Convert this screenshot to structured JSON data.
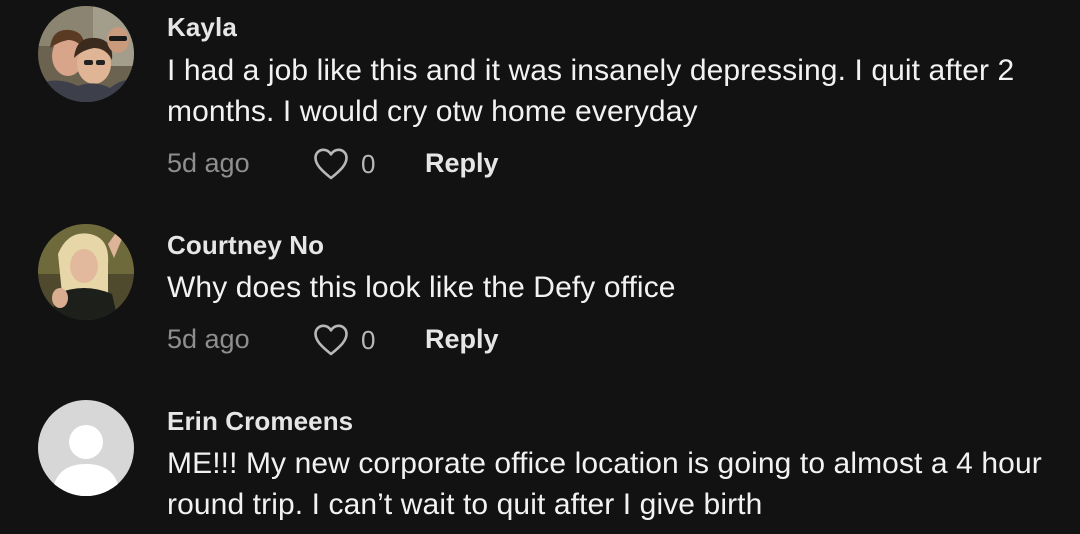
{
  "colors": {
    "background": "#121212",
    "username": "#e6e6e6",
    "text": "#f2f2f2",
    "muted": "#8e8e8e"
  },
  "comments": [
    {
      "username": "Kayla",
      "text": "I had a job like this and it was insanely depressing. I quit after 2 months. I would cry otw home everyday",
      "timestamp": "5d ago",
      "likes": "0",
      "reply_label": "Reply",
      "avatar": "photo-avatar-group"
    },
    {
      "username": "Courtney No",
      "text": "Why does this look like the Defy office",
      "timestamp": "5d ago",
      "likes": "0",
      "reply_label": "Reply",
      "avatar": "photo-avatar-selfie"
    },
    {
      "username": "Erin Cromeens",
      "text": "ME!!! My new corporate office location is going to almost a 4 hour round trip. I can’t wait to quit after I give birth",
      "avatar": "default-avatar"
    }
  ]
}
